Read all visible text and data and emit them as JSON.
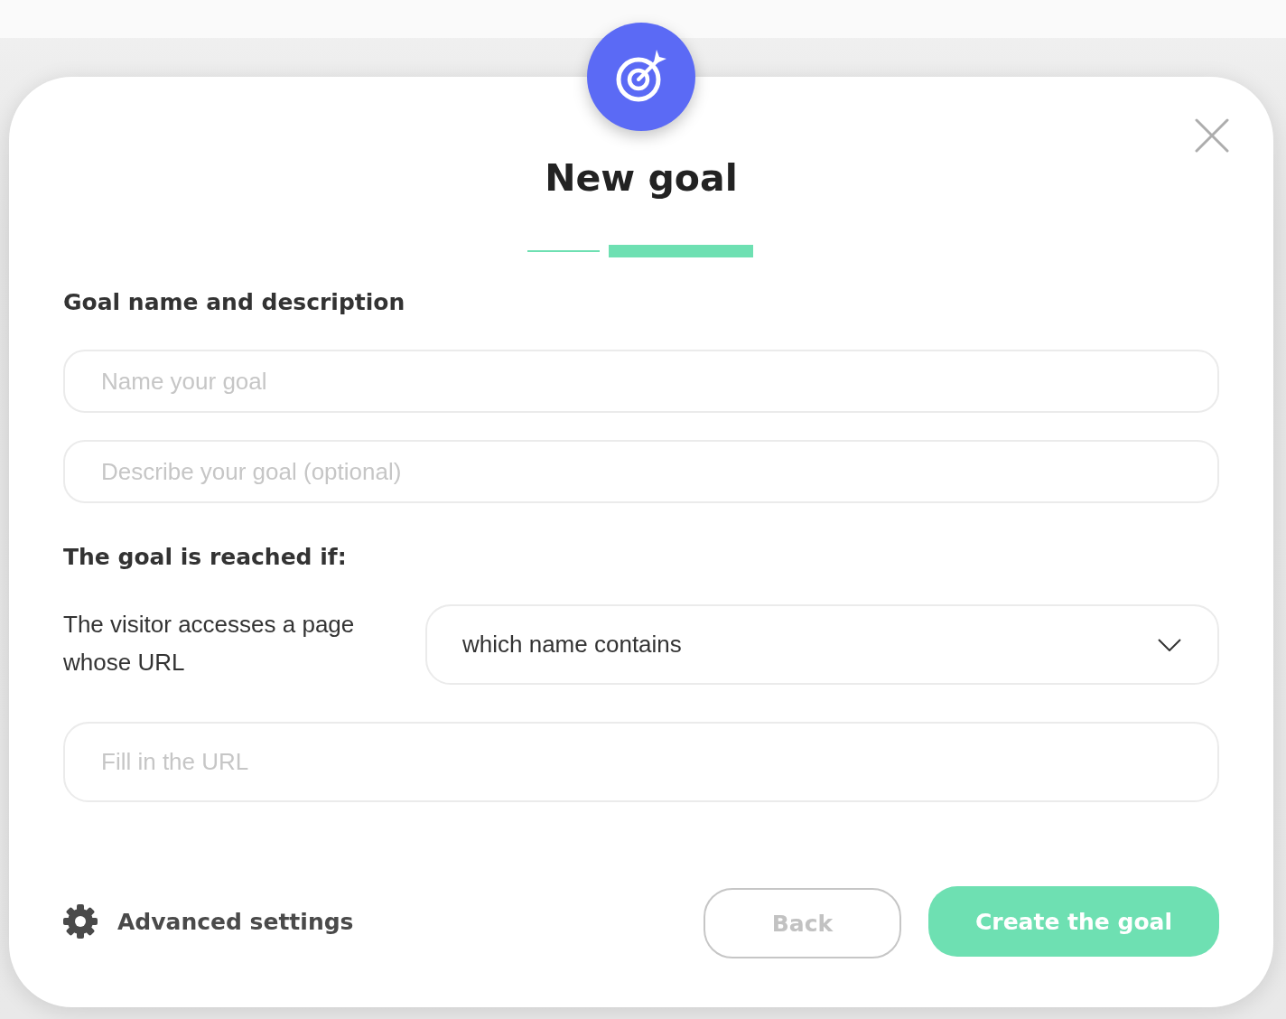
{
  "dialog": {
    "title": "New goal",
    "steps": [
      {
        "selected": false
      },
      {
        "selected": true
      }
    ]
  },
  "description_section": {
    "heading": "Goal name and description",
    "fields": [
      {
        "placeholder": "Name your goal"
      },
      {
        "placeholder": "Describe your goal (optional)"
      }
    ]
  },
  "condition_section": {
    "heading": "The goal is reached if:",
    "label": "The visitor accesses a page whose URL",
    "dropdown": {
      "value": "which name contains"
    },
    "url_field": {
      "placeholder": "Fill in the URL"
    }
  },
  "footer": {
    "advanced_settings": "Advanced settings",
    "buttons": [
      {
        "label": "Back",
        "kind": "secondary"
      },
      {
        "label": "Create the goal",
        "kind": "primary"
      }
    ]
  }
}
